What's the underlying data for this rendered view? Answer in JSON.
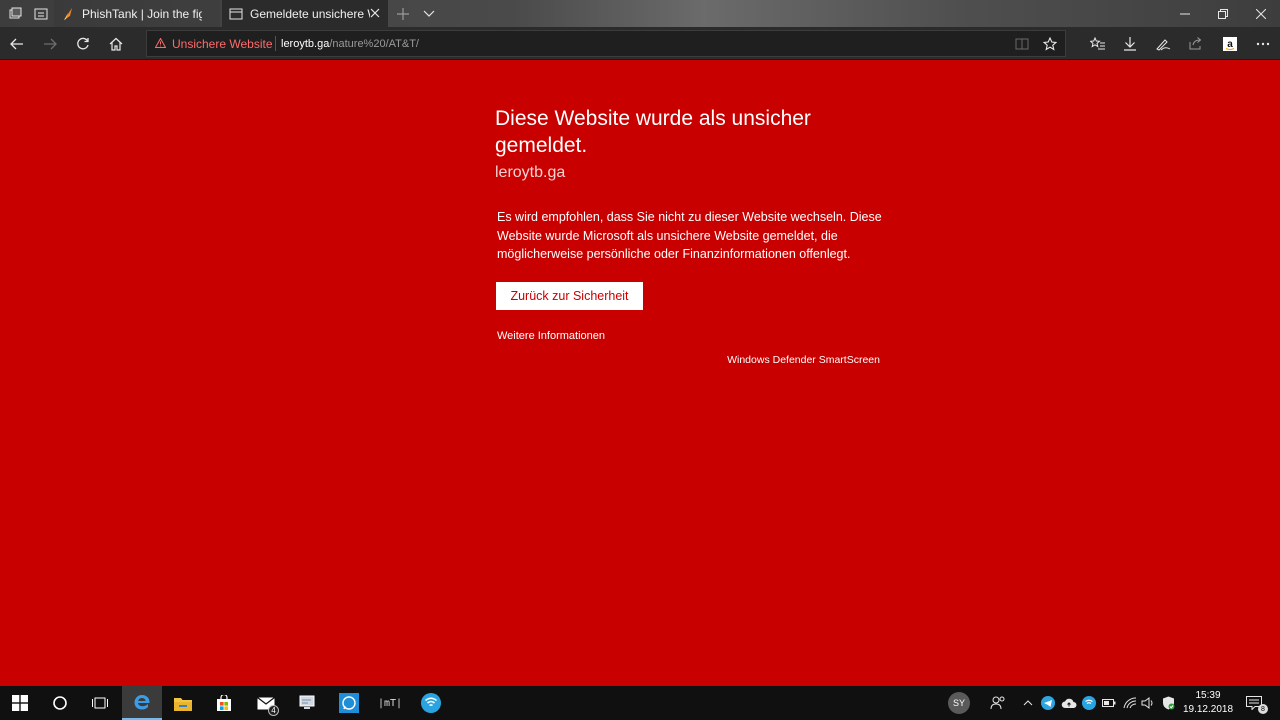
{
  "browser": {
    "tabs": [
      {
        "title": "PhishTank | Join the fight ag",
        "favicon": "phishtank-icon",
        "active": false
      },
      {
        "title": "Gemeldete unsichere W",
        "favicon": "page-icon",
        "active": true
      }
    ],
    "address_bar": {
      "warning_label": "Unsichere Website",
      "url_host": "leroytb.ga",
      "url_path": "/nature%20/AT&T/"
    }
  },
  "page": {
    "heading": "Diese Website wurde als unsicher gemeldet.",
    "domain": "leroytb.ga",
    "description": "Es wird empfohlen, dass Sie nicht zu dieser Website wechseln. Diese Website wurde Microsoft als unsichere Website gemeldet, die möglicherweise persönliche oder Finanzinformationen offenlegt.",
    "back_button": "Zurück zur Sicherheit",
    "more_info": "Weitere Informationen",
    "provider": "Windows Defender SmartScreen"
  },
  "colors": {
    "page_background": "#c80000",
    "warning_text": "#ff6b6b"
  },
  "taskbar": {
    "mail_badge": "4",
    "mt_label": "|mT|",
    "avatar_initials": "SY",
    "time": "15:39",
    "date": "19.12.2018",
    "notification_count": "8"
  }
}
